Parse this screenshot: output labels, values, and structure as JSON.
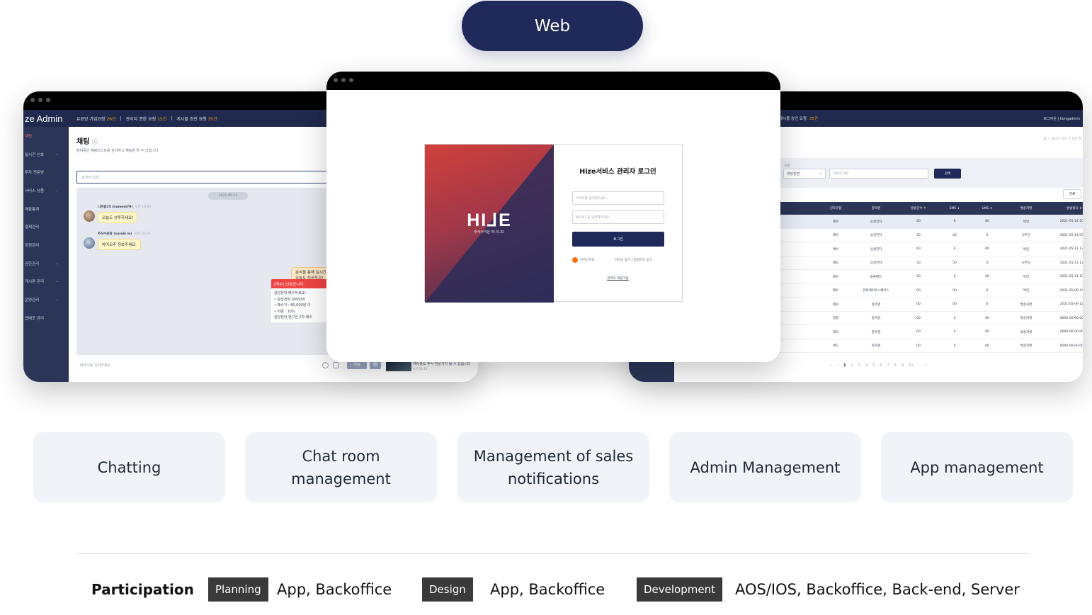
{
  "header": {
    "label": "Web"
  },
  "left_window": {
    "logo": "ze Admin",
    "notices": [
      {
        "text": "유료방 가입요청",
        "count": "26건"
      },
      {
        "text": "관리자 권한 요청",
        "count": "15건"
      },
      {
        "text": "게시물 승인 요청",
        "count": "35건"
      }
    ],
    "sidebar": [
      {
        "label": "채팅",
        "chev": ""
      },
      {
        "label": "실시간 신호",
        "chev": "⌄"
      },
      {
        "label": "투자 전문방",
        "chev": ""
      },
      {
        "label": "서비스 상품",
        "chev": "⌄"
      },
      {
        "label": "매출통계",
        "chev": ""
      },
      {
        "label": "결제관리",
        "chev": ""
      },
      {
        "label": "회원관리",
        "chev": ""
      },
      {
        "label": "권한관리",
        "chev": "⌄"
      },
      {
        "label": "게시판 관리",
        "chev": "⌄"
      },
      {
        "label": "운영관리",
        "chev": "⌄"
      },
      {
        "label": "앱배포 관리",
        "chev": ""
      }
    ],
    "chat": {
      "title": "채팅",
      "title_icon": "ⓘ",
      "description": "참여중인 채팅리스트를 관리하고 채팅을 할 수 있습니다.",
      "search_placeholder": "검색어 입력",
      "date": "2021-05-14",
      "msg1_user": "니트림25 (numem79)",
      "msg1_time": "오전 10:00",
      "msg1_text": "오늘도 성투하세요!",
      "msg2_user": "주식수운왕 (suroki m)",
      "msg2_time": "오전 10:19",
      "msg2_text": "바이오주 정보주세요.",
      "right_msg_line1": "분석을 통해 실시간",
      "right_msg_line2": "오늘도 성공투자!",
      "signal_title": "[매수] 신호입니다.",
      "signal_lines": [
        "삼성전자 매수하세요!",
        "• 삼성전자 005930",
        "• 매수가 : 80,000원 이",
        "• 비중 : 10%",
        "삼성전자 현구간 2차 매수"
      ],
      "input_placeholder": "메세지를 입력하세요.",
      "send_label": "전송",
      "thumb_text": "여러분도 주식 전문가가 될 수 있습니다",
      "thumb_sub": "오전 10:19"
    }
  },
  "center_window": {
    "logo": "HI⅃E",
    "tagline": "주식수익은 하.이.즈!",
    "title": "Hize서비스 관리자 로그인",
    "id_placeholder": "아이디를 입력해주세요.",
    "pw_placeholder": "패스워드를 입력해주세요.",
    "login_label": "로그인",
    "remember_label": "아이디저장",
    "find_links": "아이디 찾기  |  비밀번호 찾기",
    "signup_label": "관리자 회원가입"
  },
  "right_window": {
    "notice_text": "게시물 승인 요청",
    "notice_count": "35건",
    "user_links": "로그아웃  |  hongadmin",
    "breadcrumb": "홈 > 실시간 신호 > 신호 발",
    "filter_label": "구분",
    "filter_select": "채팅방명",
    "filter_input_placeholder": "검색어 입력",
    "search_label": "검색",
    "all_label": "전체",
    "columns": [
      "신호유형",
      "종목명",
      "발송건수 ↑",
      "SMS ↓",
      "LMS ↕",
      "발송자명",
      "발송일시 ↕"
    ],
    "rows": [
      [
        "매수",
        "삼성전자",
        "80",
        "0",
        "80",
        "박민",
        "2021-05-14 10:30"
      ],
      [
        "매수",
        "삼성전자",
        "50",
        "45",
        "0",
        "나주민",
        "2021-05-14 09:30"
      ],
      [
        "매수",
        "삼성전자",
        "60",
        "0",
        "60",
        "박민",
        "2021-05-11 13:30"
      ],
      [
        "매도",
        "삼성전자",
        "50",
        "50",
        "0",
        "나주민",
        "2021-05-11 12:30"
      ],
      [
        "매수",
        "블루메드",
        "60",
        "0",
        "60",
        "박민",
        "2021-05-11 10:30"
      ],
      [
        "매수",
        "한화에어로스페이스",
        "00",
        "00",
        "0",
        "박민",
        "2021-05-09 14:10"
      ],
      [
        "매수",
        "종목명",
        "00",
        "00",
        "0",
        "발송자명",
        "2021-05-09 12:10"
      ],
      [
        "결합",
        "종목명",
        "00",
        "0",
        "00",
        "발송자명",
        "0000-00-00 00:00"
      ],
      [
        "매도",
        "종목명",
        "00",
        "0",
        "00",
        "발송자명",
        "0000-00-00 00:00"
      ],
      [
        "매도",
        "종목명",
        "00",
        "0",
        "00",
        "발송자명",
        "0000-00-00 00:00"
      ]
    ],
    "pager": [
      "«",
      "‹",
      "1",
      "2",
      "3",
      "4",
      "5",
      "6",
      "7",
      "8",
      "9",
      "10",
      "›",
      "»"
    ]
  },
  "features": [
    "Chatting",
    "Chat room management",
    "Management of sales notifications",
    "Admin Management",
    "App management"
  ],
  "participation": {
    "label": "Participation",
    "items": [
      {
        "tag": "Planning",
        "value": "App, Backoffice"
      },
      {
        "tag": "Design",
        "value": "App, Backoffice"
      },
      {
        "tag": "Development",
        "value": "AOS/IOS, Backoffice, Back-end, Server"
      }
    ]
  },
  "colors": {
    "navy": "#1f2a5a",
    "card_bg": "#f0f3f8",
    "tag_bg": "#3a3a3a"
  }
}
